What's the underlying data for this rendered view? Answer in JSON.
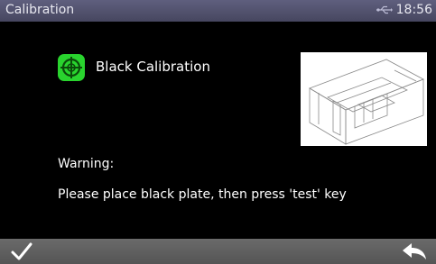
{
  "window": {
    "title": "Calibration"
  },
  "status": {
    "time": "18:56",
    "connection_icon": "usb-connection-icon"
  },
  "panel": {
    "icon": "target-icon",
    "heading": "Black Calibration",
    "warning_label": "Warning:",
    "warning_text": "Please place black plate, then press 'test' key"
  },
  "footer": {
    "confirm_icon": "checkmark-icon",
    "back_icon": "return-arrow-icon"
  },
  "colors": {
    "title_bar": "#56567a",
    "icon_green": "#29d42e",
    "footer": "#606060"
  }
}
